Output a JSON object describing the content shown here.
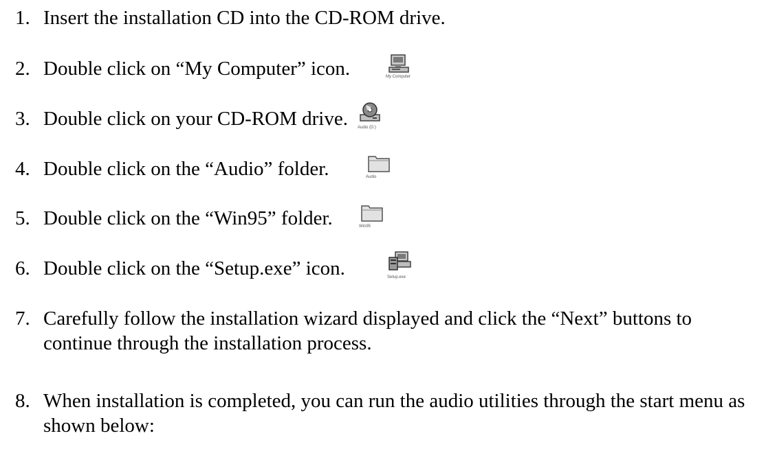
{
  "steps": [
    {
      "num": "1.",
      "text": "Insert the installation CD into the CD-ROM drive."
    },
    {
      "num": "2.",
      "text": "Double click on “My Computer” icon.",
      "icon": "my-computer-icon",
      "icon_caption": "My Computer"
    },
    {
      "num": "3.",
      "text": "Double click on your CD-ROM drive.",
      "icon": "cd-drive-icon",
      "icon_caption": "Audio (D:)"
    },
    {
      "num": "4.",
      "text": "Double click on the “Audio” folder.",
      "icon": "folder-icon",
      "icon_caption": "Audio"
    },
    {
      "num": "5.",
      "text": "Double click on the “Win95” folder.",
      "icon": "folder-icon",
      "icon_caption": "Win95"
    },
    {
      "num": "6.",
      "text": "Double click on the “Setup.exe” icon.",
      "icon": "setup-exe-icon",
      "icon_caption": "Setup.exe"
    },
    {
      "num": "7.",
      "text": "Carefully follow the installation wizard displayed and click the “Next” buttons to continue through the installation process."
    },
    {
      "num": "8.",
      "text": "When installation is completed, you can run the audio utilities through the start menu as shown below:"
    }
  ]
}
